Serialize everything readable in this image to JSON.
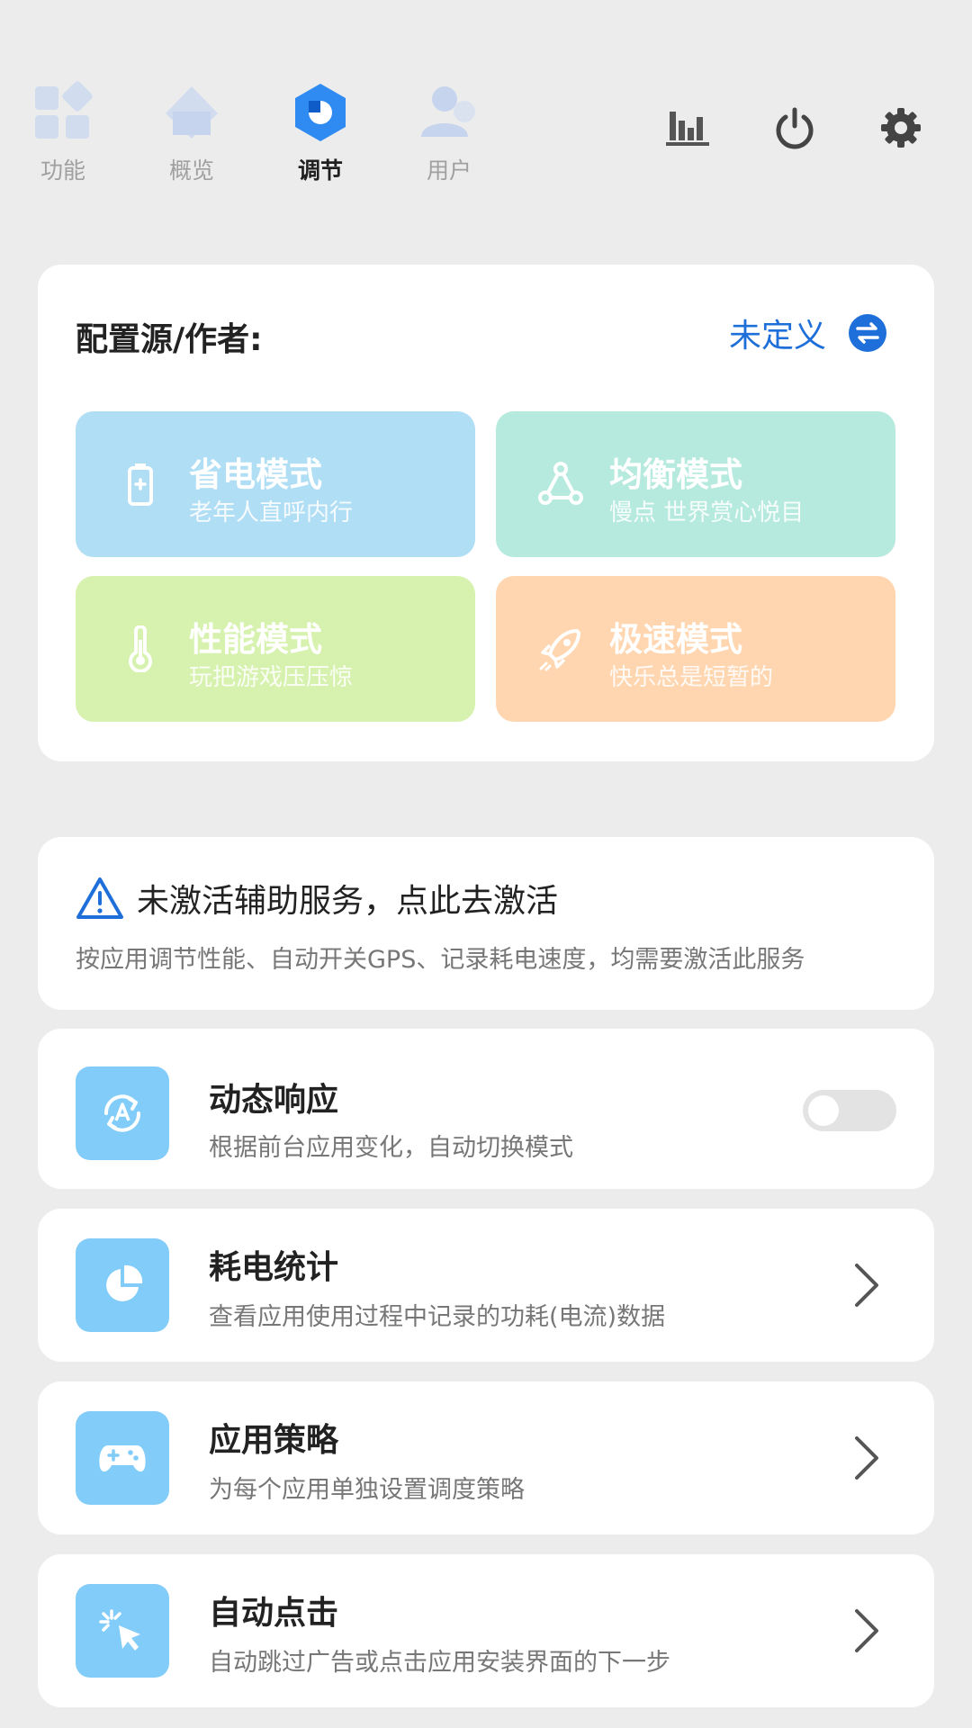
{
  "nav": {
    "tabs": [
      {
        "label": "功能",
        "icon": "grid-icon"
      },
      {
        "label": "概览",
        "icon": "overview-icon"
      },
      {
        "label": "调节",
        "icon": "hexagon-icon",
        "active": true
      },
      {
        "label": "用户",
        "icon": "user-icon"
      }
    ],
    "actions": [
      "bar-chart-icon",
      "power-icon",
      "gear-icon"
    ]
  },
  "config": {
    "title": "配置源/作者:",
    "value": "未定义",
    "modes": [
      {
        "name": "省电模式",
        "desc": "老年人直呼内行",
        "color": "#b0def5",
        "icon": "battery-icon"
      },
      {
        "name": "均衡模式",
        "desc": "慢点 世界赏心悦目",
        "color": "#b6eade",
        "icon": "triangle-nodes-icon"
      },
      {
        "name": "性能模式",
        "desc": "玩把游戏压压惊",
        "color": "#d6f2ae",
        "icon": "thermometer-icon"
      },
      {
        "name": "极速模式",
        "desc": "快乐总是短暂的",
        "color": "#ffd6b0",
        "icon": "rocket-icon"
      }
    ]
  },
  "warning": {
    "title": "未激活辅助服务，点此去激活",
    "desc": "按应用调节性能、自动开关GPS、记录耗电速度，均需要激活此服务"
  },
  "features": {
    "dynamic": {
      "title": "动态响应",
      "desc": "根据前台应用变化，自动切换模式",
      "enabled": false
    },
    "power": {
      "title": "耗电统计",
      "desc": "查看应用使用过程中记录的功耗(电流)数据"
    },
    "strategy": {
      "title": "应用策略",
      "desc": "为每个应用单独设置调度策略"
    },
    "autoclick": {
      "title": "自动点击",
      "desc": "自动跳过广告或点击应用安装界面的下一步"
    }
  },
  "colors": {
    "accent": "#1e6fd9",
    "feature_icon_bg": "#82ccf9",
    "background": "#ececec"
  }
}
